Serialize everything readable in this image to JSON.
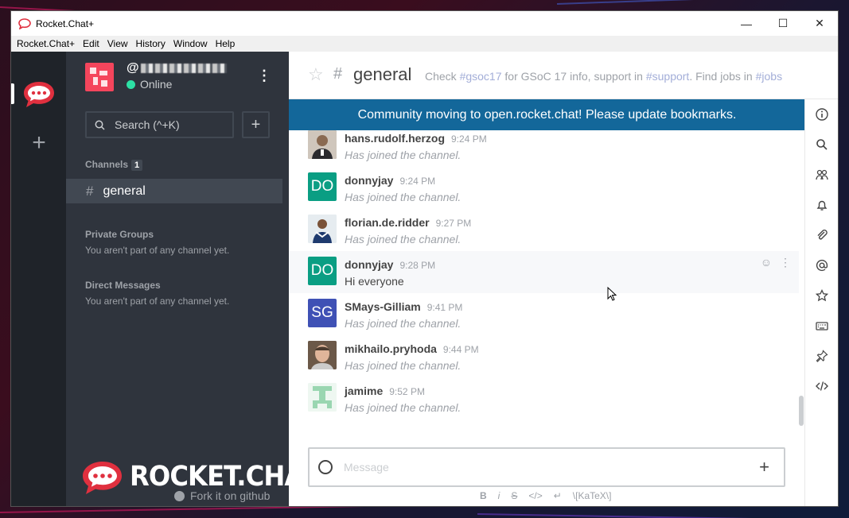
{
  "window": {
    "title": "Rocket.Chat+",
    "controls": {
      "minimize": "—",
      "maximize": "☐",
      "close": "✕"
    }
  },
  "menu": [
    "Rocket.Chat+",
    "Edit",
    "View",
    "History",
    "Window",
    "Help"
  ],
  "server_bar": {
    "add_label": "+"
  },
  "sidebar": {
    "user": {
      "name_prefix": "@",
      "status": "Online"
    },
    "search_placeholder": "Search (^+K)",
    "add_label": "+",
    "channels_title": "Channels",
    "channels_count": "1",
    "channels": [
      {
        "hash": "#",
        "name": "general"
      }
    ],
    "private_groups_title": "Private Groups",
    "private_groups_empty": "You aren't part of any channel yet.",
    "direct_messages_title": "Direct Messages",
    "direct_messages_empty": "You aren't part of any channel yet.",
    "brand": "ROCKET.CHAT",
    "fork_link": "Fork it on github"
  },
  "room": {
    "hash": "#",
    "name": "general",
    "topic": {
      "t1": "Check ",
      "l1": "#gsoc17",
      "t2": " for GSoC 17 info, support in ",
      "l2": "#support",
      "t3": ". Find jobs in ",
      "l3": "#jobs"
    },
    "banner": "Community moving to open.rocket.chat! Please update bookmarks."
  },
  "messages": [
    {
      "user": "hans.rudolf.herzog",
      "time": "9:24 PM",
      "text": "Has joined the channel.",
      "system": true,
      "initials": "",
      "avatar_color": "#6b5a4a"
    },
    {
      "user": "donnyjay",
      "time": "9:24 PM",
      "text": "Has joined the channel.",
      "system": true,
      "initials": "DO",
      "avatar_color": "#0a9e83"
    },
    {
      "user": "florian.de.ridder",
      "time": "9:27 PM",
      "text": "Has joined the channel.",
      "system": true,
      "initials": "",
      "avatar_color": "#d9e2ea"
    },
    {
      "user": "donnyjay",
      "time": "9:28 PM",
      "text": "Hi everyone",
      "system": false,
      "initials": "DO",
      "avatar_color": "#0a9e83"
    },
    {
      "user": "SMays-Gilliam",
      "time": "9:41 PM",
      "text": "Has joined the channel.",
      "system": true,
      "initials": "SG",
      "avatar_color": "#3f51b5"
    },
    {
      "user": "mikhailo.pryhoda",
      "time": "9:44 PM",
      "text": "Has joined the channel.",
      "system": true,
      "initials": "",
      "avatar_color": "#8a7563"
    },
    {
      "user": "jamime",
      "time": "9:52 PM",
      "text": "Has joined the channel.",
      "system": true,
      "initials": "",
      "avatar_color": "#e8f6ee"
    }
  ],
  "composer": {
    "placeholder": "Message",
    "add_label": "+"
  },
  "format_bar": [
    "B",
    "i",
    "S",
    "</>",
    "↵",
    "\\[KaTeX\\]"
  ],
  "flex_tab_icons": [
    "info-icon",
    "search-icon",
    "members-icon",
    "bell-icon",
    "attachment-icon",
    "mention-icon",
    "star-icon",
    "keyboard-icon",
    "pin-icon",
    "code-icon"
  ],
  "colors": {
    "sidebar": "#2f343d",
    "server_bar": "#1f2329",
    "banner": "#13679a",
    "online": "#2de0a5",
    "brand_red": "#f5455c"
  }
}
